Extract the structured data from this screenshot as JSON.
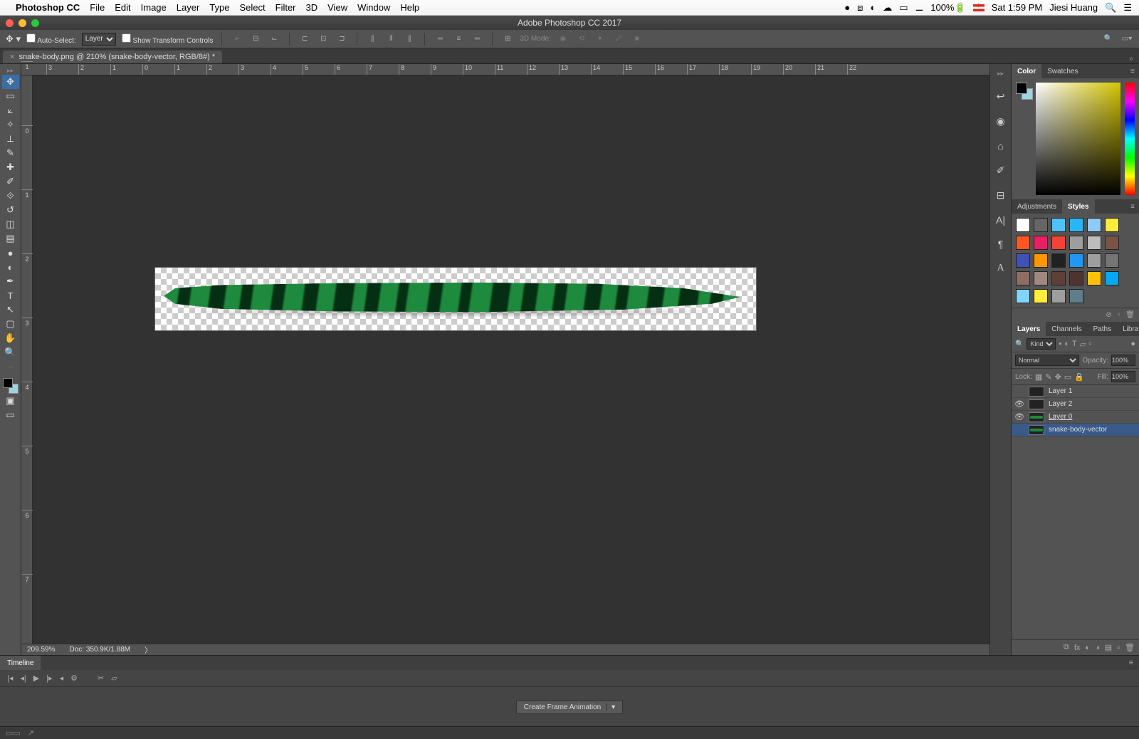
{
  "mac_menu": {
    "app": "Photoshop CC",
    "items": [
      "File",
      "Edit",
      "Image",
      "Layer",
      "Type",
      "Select",
      "Filter",
      "3D",
      "View",
      "Window",
      "Help"
    ],
    "battery": "100%",
    "date": "Sat 1:59 PM",
    "user": "Jiesi Huang"
  },
  "window_title": "Adobe Photoshop CC 2017",
  "options": {
    "auto_select_label": "Auto-Select:",
    "auto_select_value": "Layer",
    "show_transform_label": "Show Transform Controls",
    "mode3d_label": "3D Mode:"
  },
  "doc_tab": "snake-body.png @ 210% (snake-body-vector, RGB/8#) *",
  "ruler_h": [
    "",
    "3",
    "2",
    "1",
    "0",
    "1",
    "2",
    "3",
    "4",
    "5",
    "6",
    "7",
    "8",
    "9",
    "10",
    "11",
    "12",
    "13",
    "14",
    "15",
    "16",
    "17",
    "18",
    "19",
    "20",
    "21",
    "22"
  ],
  "ruler_v": [
    "1",
    "0",
    "1",
    "2",
    "3",
    "4",
    "5",
    "6",
    "7"
  ],
  "status": {
    "zoom": "209.59%",
    "doc": "Doc: 350.9K/1.88M"
  },
  "panels": {
    "color_tabs": [
      "Color",
      "Swatches"
    ],
    "adj_tabs": [
      "Adjustments",
      "Styles"
    ],
    "layer_tabs": [
      "Layers",
      "Channels",
      "Paths",
      "Libraries"
    ],
    "kind_label": "Kind",
    "blend_mode": "Normal",
    "opacity_label": "Opacity:",
    "opacity_val": "100%",
    "lock_label": "Lock:",
    "fill_label": "Fill:",
    "fill_val": "100%",
    "layers": [
      {
        "name": "Layer 1",
        "visible": false,
        "thumb": "dark"
      },
      {
        "name": "Layer 2",
        "visible": true,
        "thumb": "dark"
      },
      {
        "name": "Layer 0",
        "visible": true,
        "thumb": "green",
        "underline": true
      },
      {
        "name": "snake-body-vector",
        "visible": false,
        "thumb": "green",
        "selected": true,
        "smart": true
      }
    ]
  },
  "timeline": {
    "tab": "Timeline",
    "create_btn": "Create Frame Animation"
  },
  "style_swatches": [
    "#fff",
    "#666",
    "#4fc3f7",
    "#29b6f6",
    "#90caf9",
    "#ffeb3b",
    "#ff5722",
    "#e91e63",
    "#f44336",
    "#9e9e9e",
    "#bdbdbd",
    "#795548",
    "#3f51b5",
    "#ff9800",
    "#212121",
    "#2196f3",
    "#9e9e9e",
    "#757575",
    "#8d6e63",
    "#a1887f",
    "#5d4037",
    "#4e342e",
    "#ffc107",
    "#03a9f4",
    "#81d4fa",
    "#ffeb3b",
    "#9e9e9e",
    "#607d8b"
  ]
}
